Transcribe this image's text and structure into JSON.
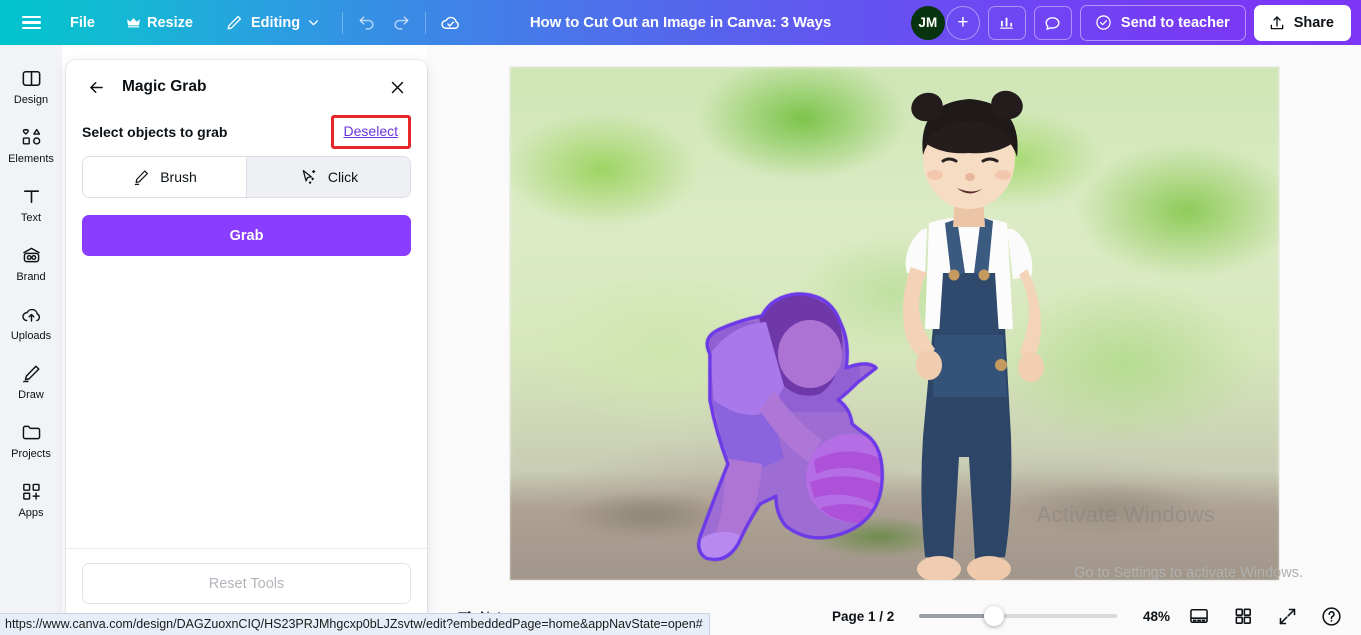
{
  "topbar": {
    "menu_icon": "hamburger-icon",
    "file_label": "File",
    "resize_label": "Resize",
    "resize_badge_icon": "crown-icon",
    "editing_label": "Editing",
    "editing_chevron_icon": "chevron-down-icon",
    "undo_icon": "undo-icon",
    "redo_icon": "redo-icon",
    "cloud_icon": "cloud-saved-icon",
    "doc_title": "How to Cut Out an Image in Canva: 3 Ways",
    "avatar_initials": "JM",
    "avatar_color": "#07330f",
    "add_collaborator_label": "+",
    "insights_icon": "bar-chart-icon",
    "comments_icon": "comment-bubble-icon",
    "send_to_teacher_label": "Send to teacher",
    "send_to_teacher_icon": "check-circle-icon",
    "share_label": "Share",
    "share_icon": "upload-icon",
    "gradient_start": "#00c4cc",
    "gradient_end": "#7d36f6"
  },
  "sidebar": {
    "items": [
      {
        "label": "Design",
        "icon": "design-layout-icon"
      },
      {
        "label": "Elements",
        "icon": "elements-shapes-icon"
      },
      {
        "label": "Text",
        "icon": "text-t-icon"
      },
      {
        "label": "Brand",
        "icon": "brand-icon"
      },
      {
        "label": "Uploads",
        "icon": "upload-cloud-icon"
      },
      {
        "label": "Draw",
        "icon": "draw-pen-icon"
      },
      {
        "label": "Projects",
        "icon": "folder-icon"
      },
      {
        "label": "Apps",
        "icon": "apps-grid-plus-icon"
      }
    ]
  },
  "panel": {
    "title": "Magic Grab",
    "back_icon": "arrow-left-icon",
    "close_icon": "close-x-icon",
    "select_label": "Select objects to grab",
    "deselect_label": "Deselect",
    "deselect_link_color": "#6a36d9",
    "highlight_box_color": "#e8252b",
    "tools": [
      {
        "label": "Brush",
        "icon": "brush-pen-icon",
        "active": false
      },
      {
        "label": "Click",
        "icon": "magic-cursor-icon",
        "active": true
      }
    ],
    "grab_label": "Grab",
    "grab_color": "#8b3dff",
    "reset_label": "Reset Tools"
  },
  "canvas": {
    "image_alt": "Two young children playing on grass; the bending child holding a ball is highlighted with a purple selection overlay",
    "selection_color": "#8b3dff",
    "selection_outline_color": "#6d3ae8",
    "watermark_title": "Activate Windows",
    "watermark_subtitle": "Go to Settings to activate Windows."
  },
  "bottombar": {
    "notes_label": "Notes",
    "notes_icon": "notes-icon",
    "page_count": "Page 1 / 2",
    "zoom_value": "48%",
    "zoom_percent": 48,
    "icons": [
      {
        "name": "page-view-icon"
      },
      {
        "name": "grid-view-icon"
      },
      {
        "name": "fullscreen-icon"
      },
      {
        "name": "help-icon"
      }
    ]
  },
  "status": {
    "url": "https://www.canva.com/design/DAGZuoxnCIQ/HS23PRJMhgcxp0bLJZsvtw/edit?embeddedPage=home&appNavState=open#"
  }
}
